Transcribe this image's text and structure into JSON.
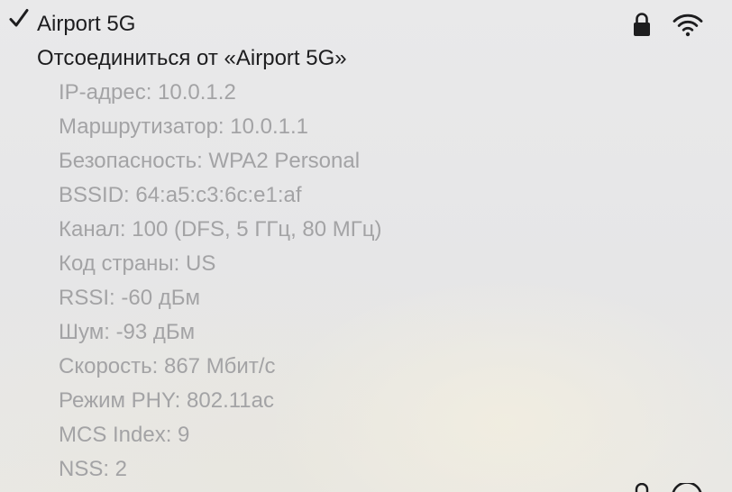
{
  "network": {
    "name": "Airport 5G",
    "connected": true,
    "icons": [
      "checkmark-icon",
      "lock-icon",
      "wifi-icon"
    ]
  },
  "menu": {
    "disconnect_label": "Отсоединиться от «Airport 5G»"
  },
  "details": [
    "IP-адрес: 10.0.1.2",
    "Маршрутизатор: 10.0.1.1",
    "Безопасность: WPA2 Personal",
    "BSSID: 64:a5:c3:6c:e1:af",
    "Канал: 100 (DFS, 5 ГГц, 80 МГц)",
    "Код страны: US",
    "RSSI: -60 дБм",
    "Шум: -93 дБм",
    "Скорость: 867 Мбит/с",
    "Режим PHY: 802.11ac",
    "MCS Index: 9",
    "NSS: 2"
  ],
  "colors": {
    "primary_text": "#1d1d1f",
    "disabled_text": "#a3a3a5",
    "background": "#e7e7e8"
  }
}
